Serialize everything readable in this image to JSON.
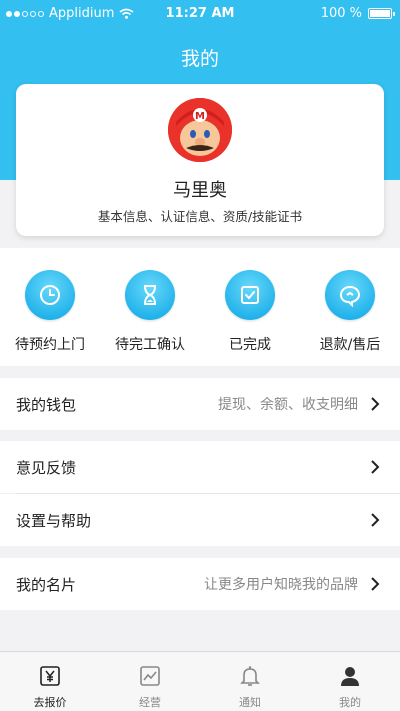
{
  "status_bar": {
    "carrier": "Applidium",
    "time": "11:27 AM",
    "battery": "100 %"
  },
  "page_title": "我的",
  "profile": {
    "name": "马里奥",
    "subtitle": "基本信息、认证信息、资质/技能证书"
  },
  "order_status": [
    {
      "label": "待预约上门",
      "icon": "clock-icon"
    },
    {
      "label": "待完工确认",
      "icon": "hourglass-icon"
    },
    {
      "label": "已完成",
      "icon": "check-icon"
    },
    {
      "label": "退款/售后",
      "icon": "refund-icon"
    }
  ],
  "menu": {
    "wallet": {
      "label": "我的钱包",
      "hint": "提现、余额、收支明细"
    },
    "feedback": {
      "label": "意见反馈"
    },
    "settings": {
      "label": "设置与帮助"
    },
    "card": {
      "label": "我的名片",
      "hint": "让更多用户知晓我的品牌"
    }
  },
  "tabs": [
    {
      "label": "去报价",
      "icon": "yen-icon"
    },
    {
      "label": "经营",
      "icon": "chart-icon"
    },
    {
      "label": "通知",
      "icon": "bell-icon"
    },
    {
      "label": "我的",
      "icon": "person-icon"
    }
  ],
  "colors": {
    "accent": "#33bff0",
    "icon_blue": "#20b2ea"
  }
}
